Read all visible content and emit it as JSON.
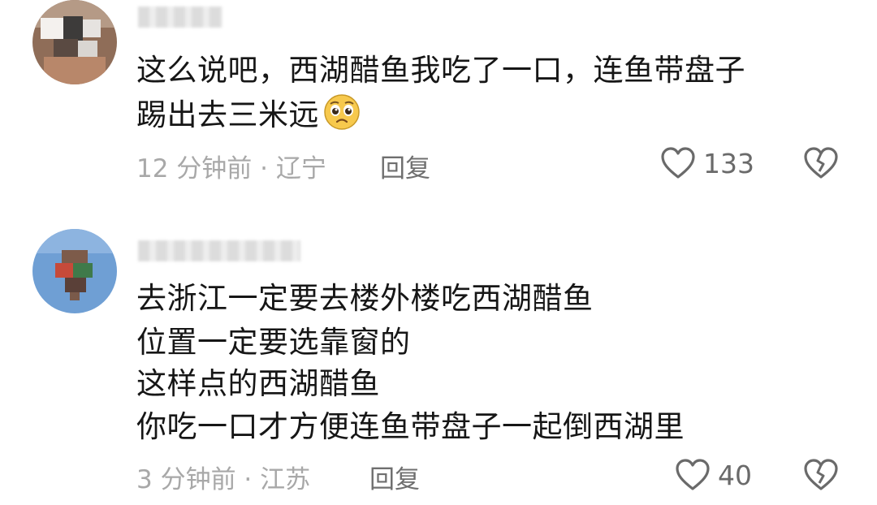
{
  "comments": [
    {
      "lines": [
        "这么说吧，西湖醋鱼我吃了一口，连鱼带盘子",
        "踢出去三米远"
      ],
      "meta": "12 分钟前 · 辽宁",
      "reply_label": "回复",
      "like_count": "133",
      "emoji_icon": "pleading-face-icon"
    },
    {
      "lines": [
        "去浙江一定要去楼外楼吃西湖醋鱼",
        "位置一定要选靠窗的",
        "这样点的西湖醋鱼",
        "你吃一口才方便连鱼带盘子一起倒西湖里"
      ],
      "meta": "3 分钟前 · 江苏",
      "reply_label": "回复",
      "like_count": "40"
    }
  ],
  "colors": {
    "text": "#161616",
    "meta": "#a8a8a8",
    "icon": "#6a6a6a"
  }
}
